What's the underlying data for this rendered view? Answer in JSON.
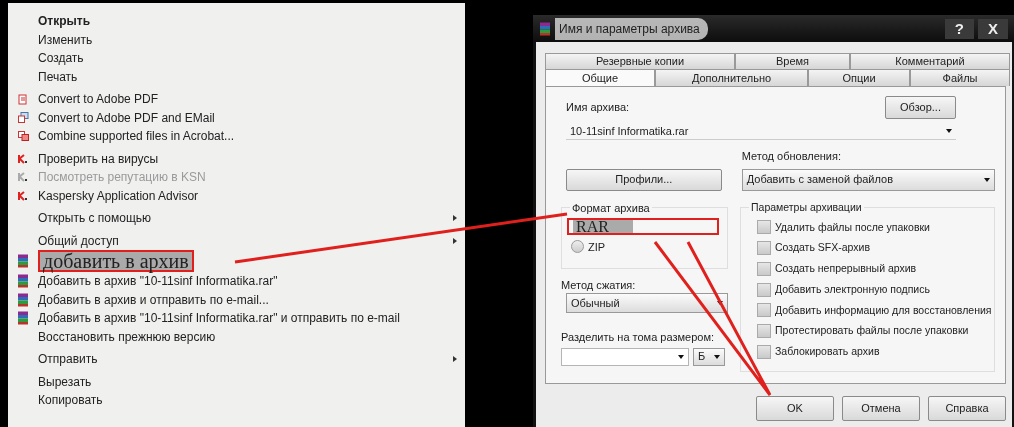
{
  "context_menu": {
    "items": [
      {
        "kind": "item",
        "label": "Открыть",
        "default": true,
        "disabled": false,
        "submenu": false
      },
      {
        "kind": "item",
        "label": "Изменить",
        "default": false,
        "disabled": false,
        "submenu": false
      },
      {
        "kind": "item",
        "label": "Создать",
        "default": false,
        "disabled": false,
        "submenu": false
      },
      {
        "kind": "item",
        "label": "Печать",
        "default": false,
        "disabled": false,
        "submenu": false
      },
      {
        "kind": "separator"
      },
      {
        "kind": "item",
        "label": "Convert to Adobe PDF",
        "default": false,
        "disabled": false,
        "submenu": false
      },
      {
        "kind": "item",
        "label": "Convert to Adobe PDF and EMail",
        "default": false,
        "disabled": false,
        "submenu": false
      },
      {
        "kind": "item",
        "label": "Combine supported files in Acrobat...",
        "default": false,
        "disabled": false,
        "submenu": false
      },
      {
        "kind": "separator"
      },
      {
        "kind": "item",
        "label": "Проверить на вирусы",
        "default": false,
        "disabled": false,
        "submenu": false
      },
      {
        "kind": "item",
        "label": "Посмотреть репутацию в KSN",
        "default": false,
        "disabled": true,
        "submenu": false
      },
      {
        "kind": "item",
        "label": "Kaspersky Application Advisor",
        "default": false,
        "disabled": false,
        "submenu": false
      },
      {
        "kind": "separator"
      },
      {
        "kind": "item",
        "label": "Открыть с помощью",
        "default": false,
        "disabled": false,
        "submenu": true
      },
      {
        "kind": "separator"
      },
      {
        "kind": "item",
        "label": "Общий доступ",
        "default": false,
        "disabled": false,
        "submenu": true
      },
      {
        "kind": "callout",
        "label": "добавить в архив"
      },
      {
        "kind": "item",
        "label": "Добавить в архив \"10-11sinf Informatika.rar\"",
        "default": false,
        "disabled": false,
        "submenu": false
      },
      {
        "kind": "item",
        "label": "Добавить в архив и отправить по e-mail...",
        "default": false,
        "disabled": false,
        "submenu": false
      },
      {
        "kind": "item",
        "label": "Добавить в архив \"10-11sinf Informatika.rar\" и отправить по e-mail",
        "default": false,
        "disabled": false,
        "submenu": false
      },
      {
        "kind": "item",
        "label": "Восстановить прежнюю версию",
        "default": false,
        "disabled": false,
        "submenu": false
      },
      {
        "kind": "separator"
      },
      {
        "kind": "item",
        "label": "Отправить",
        "default": false,
        "disabled": false,
        "submenu": true
      },
      {
        "kind": "separator"
      },
      {
        "kind": "item",
        "label": "Вырезать",
        "default": false,
        "disabled": false,
        "submenu": false
      },
      {
        "kind": "item",
        "label": "Копировать",
        "default": false,
        "disabled": false,
        "submenu": false
      }
    ]
  },
  "dialog": {
    "title": "Имя и параметры архива",
    "title_buttons": [
      "?",
      "X"
    ],
    "tab_rows": [
      [
        {
          "label": "Резервные копии",
          "selected": false
        },
        {
          "label": "Время",
          "selected": false
        },
        {
          "label": "Комментарий",
          "selected": false
        }
      ],
      [
        {
          "label": "Общие",
          "selected": true
        },
        {
          "label": "Дополнительно",
          "selected": false
        },
        {
          "label": "Опции",
          "selected": false
        },
        {
          "label": "Файлы",
          "selected": false
        }
      ]
    ],
    "archive_name_label": "Имя архива:",
    "browse_button": "Обзор...",
    "archive_name": "10-11sinf Informatika.rar",
    "profiles_button": "Профили...",
    "update_method_label": "Метод обновления:",
    "update_method": "Добавить с заменой файлов",
    "format_label": "Формат архива",
    "formats": [
      {
        "kind": "callout",
        "label": "RAR"
      },
      {
        "kind": "radio",
        "label": "ZIP",
        "checked": false
      }
    ],
    "compression_label": "Метод сжатия:",
    "compression": "Обычный",
    "split_label": "Разделить на тома размером:",
    "split_unit": "Б",
    "options_label": "Параметры архивации",
    "options": [
      {
        "label": "Удалить файлы после упаковки",
        "checked": false
      },
      {
        "label": "Создать SFX-архив",
        "checked": false
      },
      {
        "label": "Создать непрерывный архив",
        "checked": false
      },
      {
        "label": "Добавить электронную подпись",
        "checked": false
      },
      {
        "label": "Добавить информацию для восстановления",
        "checked": false
      },
      {
        "label": "Протестировать файлы после упаковки",
        "checked": false
      },
      {
        "label": "Заблокировать архив",
        "checked": false
      }
    ],
    "buttons": [
      "OK",
      "Отмена",
      "Справка"
    ]
  }
}
